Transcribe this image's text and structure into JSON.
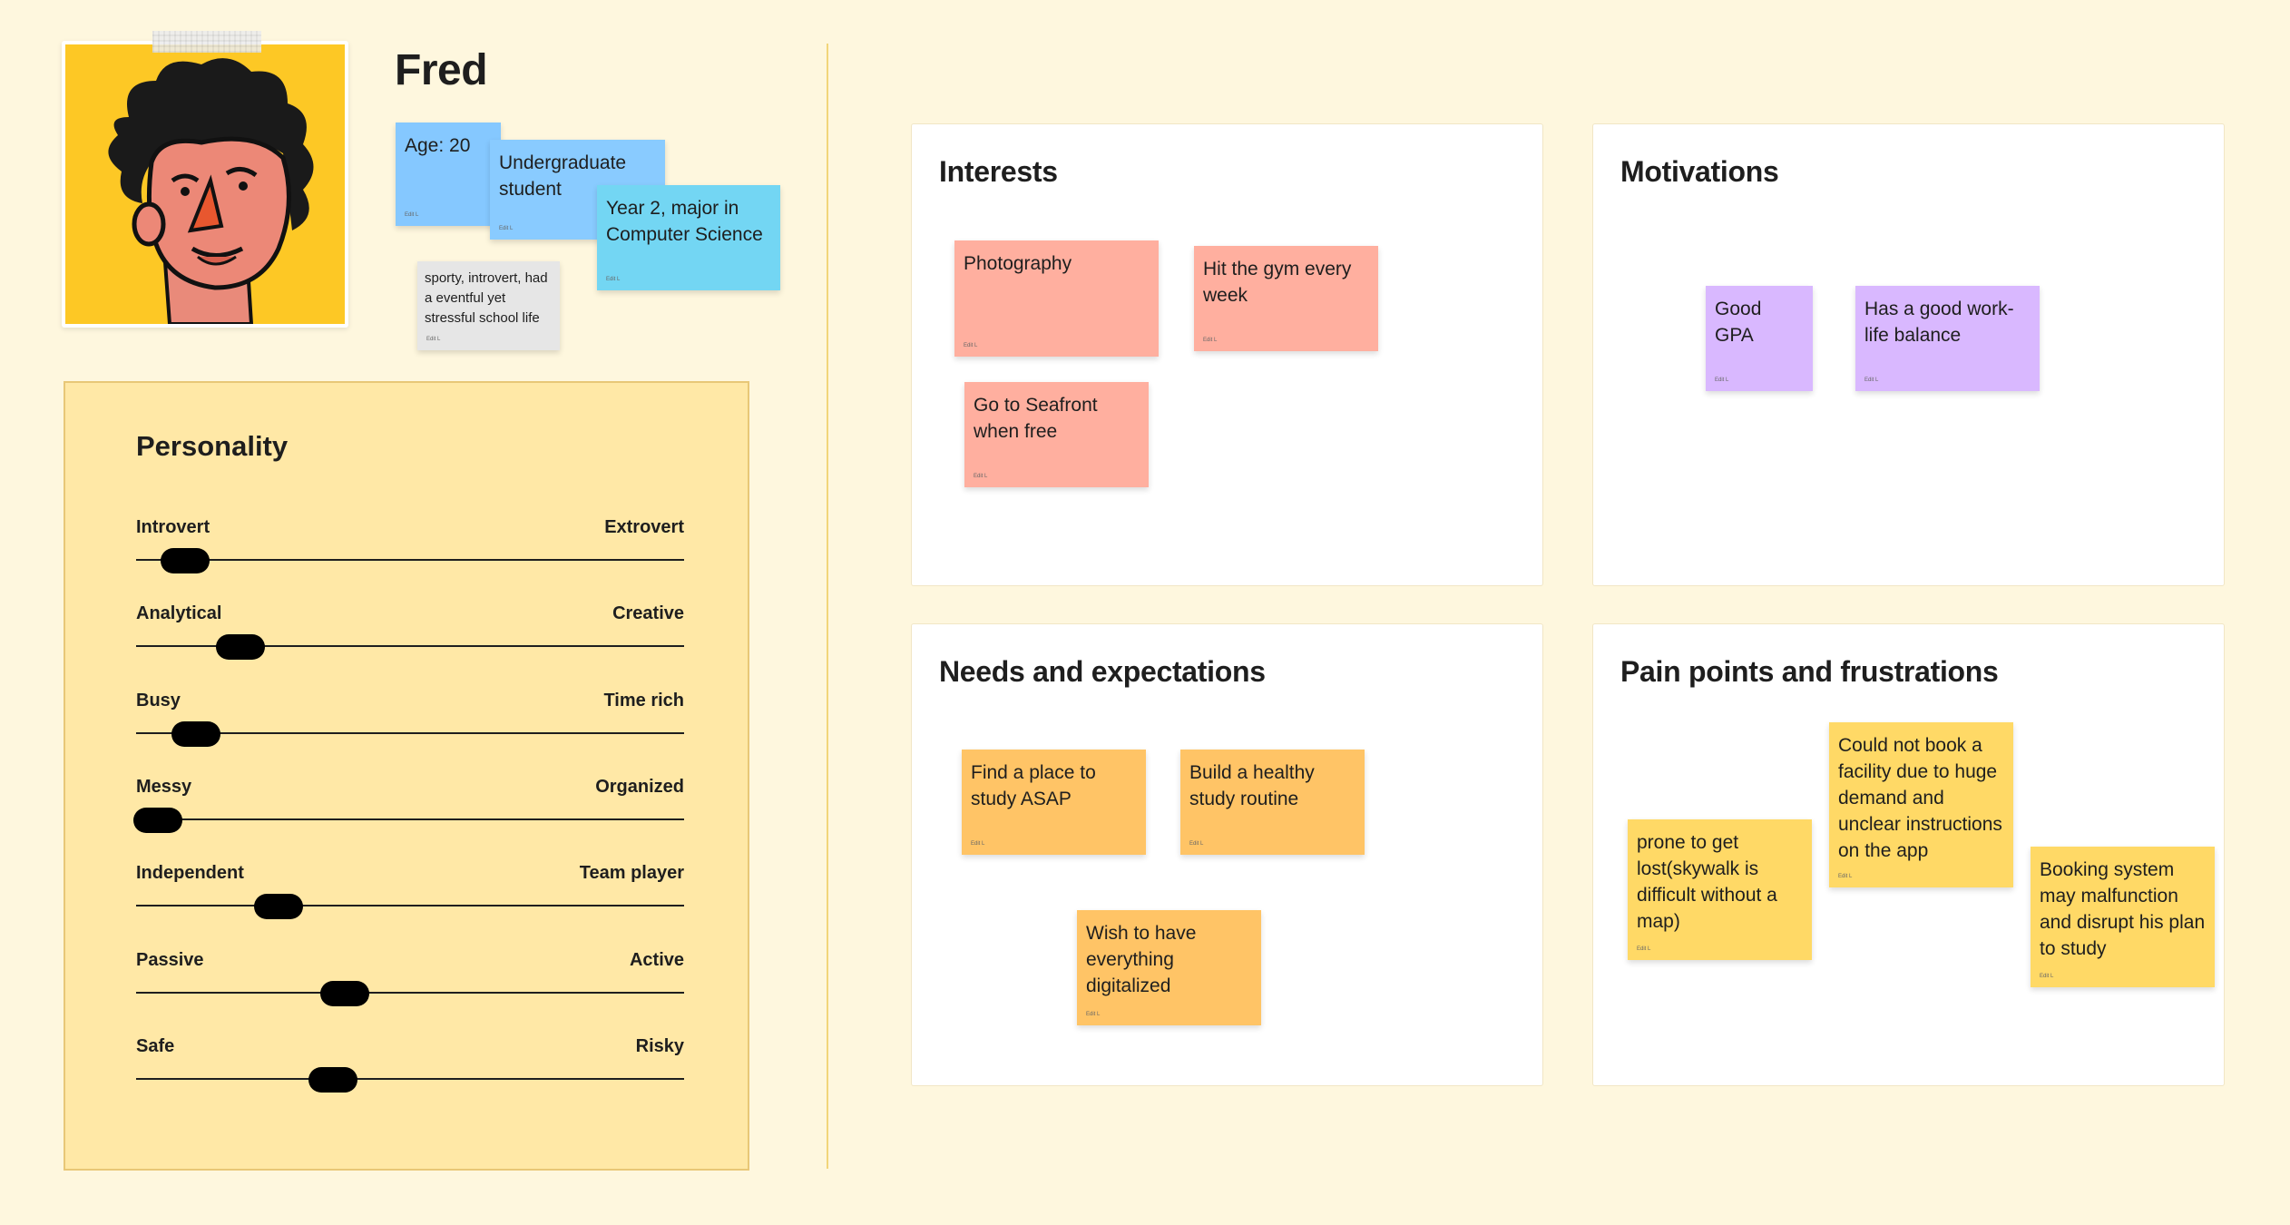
{
  "persona": {
    "name": "Fred",
    "avatar": "curly-haired-man-illustration",
    "facts": [
      "Age: 20",
      "Undergraduate student",
      "Year 2, major in Computer Science"
    ],
    "description": "sporty, introvert, had a eventful yet stressful school life",
    "sticky_author": "Edit L"
  },
  "personality": {
    "title": "Personality",
    "traits": [
      {
        "left": "Introvert",
        "right": "Extrovert",
        "value": 0.09
      },
      {
        "left": "Analytical",
        "right": "Creative",
        "value": 0.19
      },
      {
        "left": "Busy",
        "right": "Time rich",
        "value": 0.11
      },
      {
        "left": "Messy",
        "right": "Organized",
        "value": 0.04
      },
      {
        "left": "Independent",
        "right": "Team player",
        "value": 0.26
      },
      {
        "left": "Passive",
        "right": "Active",
        "value": 0.38
      },
      {
        "left": "Safe",
        "right": "Risky",
        "value": 0.36
      }
    ]
  },
  "panels": {
    "interests": {
      "title": "Interests",
      "notes": [
        "Photography",
        "Hit the gym every week",
        "Go to Seafront when free"
      ]
    },
    "motivations": {
      "title": "Motivations",
      "notes": [
        "Good GPA",
        "Has a good work-life balance"
      ]
    },
    "needs": {
      "title": "Needs and expectations",
      "notes": [
        "Find a place to study ASAP",
        "Build a healthy study routine",
        "Wish to have everything digitalized"
      ]
    },
    "pain_points": {
      "title": "Pain points and frustrations",
      "notes": [
        "prone to get lost(skywalk is difficult without a map)",
        "Could not book a facility due to huge demand and unclear instructions on the app",
        "Booking system may malfunction and disrupt his plan to study"
      ]
    }
  },
  "colors": {
    "background": "#fef7de",
    "personality_panel": "#ffe8a6",
    "sticky_blue": "#85c8ff",
    "sticky_cyan": "#73d6f3",
    "sticky_salmon": "#ffaf9f",
    "sticky_purple": "#d9b8ff",
    "sticky_orange": "#ffc466",
    "sticky_yellow": "#ffd966",
    "avatar_bg": "#fdc825"
  }
}
